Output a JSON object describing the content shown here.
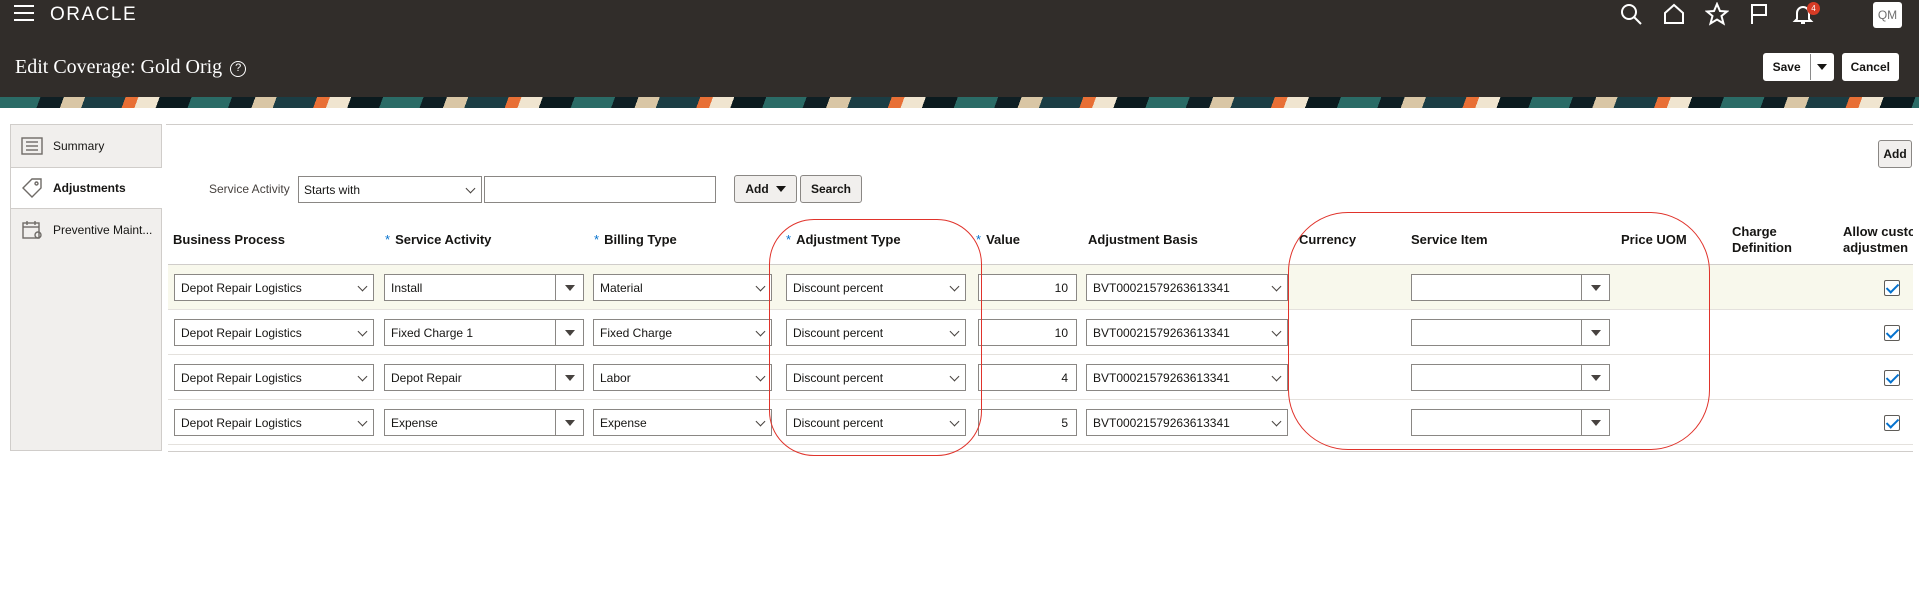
{
  "header": {
    "brand": "ORACLE",
    "page_title": "Edit Coverage: Gold Orig",
    "help_icon": "?",
    "notification_count": "4",
    "user_initials": "QM",
    "save_label": "Save",
    "cancel_label": "Cancel"
  },
  "sidebar": {
    "items": [
      {
        "label": "Summary",
        "icon": "summary-icon",
        "active": false
      },
      {
        "label": "Adjustments",
        "icon": "tag-icon",
        "active": true
      },
      {
        "label": "Preventive Maint...",
        "icon": "calendar-icon",
        "active": false
      }
    ]
  },
  "toolbar": {
    "add_label": "Add"
  },
  "filter": {
    "label": "Service Activity",
    "operator": "Starts with",
    "value": "",
    "add_label": "Add",
    "search_label": "Search"
  },
  "table": {
    "columns": {
      "business_process": "Business Process",
      "service_activity": "Service Activity",
      "billing_type": "Billing Type",
      "adjustment_type": "Adjustment Type",
      "value": "Value",
      "adjustment_basis": "Adjustment Basis",
      "currency": "Currency",
      "service_item": "Service Item",
      "price_uom": "Price UOM",
      "charge_definition_1": "Charge",
      "charge_definition_2": "Definition",
      "allow_custom_1": "Allow custo",
      "allow_custom_2": "adjustmen"
    },
    "rows": [
      {
        "business_process": "Depot Repair Logistics",
        "service_activity": "Install",
        "billing_type": "Material",
        "adjustment_type": "Discount percent",
        "value": "10",
        "adjustment_basis": "BVT00021579263613341",
        "currency": "",
        "service_item": "",
        "allow_custom": true
      },
      {
        "business_process": "Depot Repair Logistics",
        "service_activity": "Fixed Charge 1",
        "billing_type": "Fixed Charge",
        "adjustment_type": "Discount percent",
        "value": "10",
        "adjustment_basis": "BVT00021579263613341",
        "currency": "",
        "service_item": "",
        "allow_custom": true
      },
      {
        "business_process": "Depot Repair Logistics",
        "service_activity": "Depot Repair",
        "billing_type": "Labor",
        "adjustment_type": "Discount percent",
        "value": "4",
        "adjustment_basis": "BVT00021579263613341",
        "currency": "",
        "service_item": "",
        "allow_custom": true
      },
      {
        "business_process": "Depot Repair Logistics",
        "service_activity": "Expense",
        "billing_type": "Expense",
        "adjustment_type": "Discount percent",
        "value": "5",
        "adjustment_basis": "BVT00021579263613341",
        "currency": "",
        "service_item": "",
        "allow_custom": true
      }
    ]
  },
  "colors": {
    "header_bg": "#312d2a",
    "required_marker": "#0572ce",
    "annotation": "#e0332b",
    "selected_row": "#f8f8ec"
  }
}
